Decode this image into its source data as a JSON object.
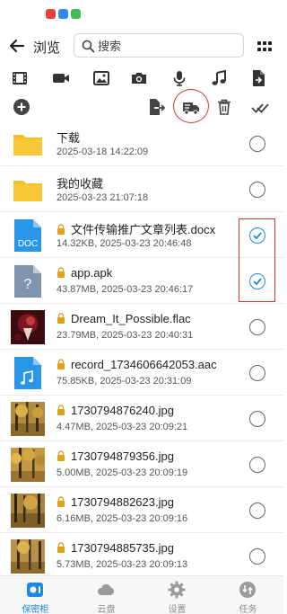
{
  "header": {
    "title": "浏览"
  },
  "search": {
    "placeholder": "搜索"
  },
  "colors": {
    "accent": "#1e88e5",
    "folder": "#f6c02d",
    "highlight": "#d8352b"
  },
  "file_types": [
    "film-icon",
    "video-icon",
    "image-icon",
    "camera-icon",
    "microphone-icon",
    "music-icon",
    "document-icon"
  ],
  "actions": [
    "add-icon",
    "export-icon",
    "move-icon",
    "delete-icon",
    "select-all-icon"
  ],
  "files": [
    {
      "name": "下载",
      "meta": "2025-03-18 14:22:09",
      "kind": "folder",
      "checked": false,
      "locked": false
    },
    {
      "name": "我的收藏",
      "meta": "2025-03-23 21:07:18",
      "kind": "folder",
      "checked": false,
      "locked": false
    },
    {
      "name": "文件传输推广文章列表.docx",
      "meta": "14.32KB, 2025-03-23 20:46:48",
      "kind": "doc",
      "badge": "DOC",
      "checked": true,
      "locked": true
    },
    {
      "name": "app.apk",
      "meta": "43.87MB, 2025-03-23 20:46:17",
      "kind": "unknown",
      "badge": "?",
      "checked": true,
      "locked": true
    },
    {
      "name": "Dream_It_Possible.flac",
      "meta": "23.79MB, 2025-03-23 20:40:31",
      "kind": "album",
      "checked": false,
      "locked": true
    },
    {
      "name": "record_1734606642053.aac",
      "meta": "75.85KB, 2025-03-23 20:31:09",
      "kind": "audio",
      "checked": false,
      "locked": true
    },
    {
      "name": "1730794876240.jpg",
      "meta": "4.47MB, 2025-03-23 20:09:21",
      "kind": "photo",
      "checked": false,
      "locked": true
    },
    {
      "name": "1730794879356.jpg",
      "meta": "5.00MB, 2025-03-23 20:09:19",
      "kind": "photo",
      "checked": false,
      "locked": true
    },
    {
      "name": "1730794882623.jpg",
      "meta": "6.16MB, 2025-03-23 20:09:16",
      "kind": "photo",
      "checked": false,
      "locked": true
    },
    {
      "name": "1730794885735.jpg",
      "meta": "5.73MB, 2025-03-23 20:09:13",
      "kind": "photo",
      "checked": false,
      "locked": true
    }
  ],
  "nav": [
    {
      "label": "保密柜",
      "icon": "vault-icon",
      "active": true
    },
    {
      "label": "云盘",
      "icon": "cloud-icon",
      "active": false
    },
    {
      "label": "设置",
      "icon": "gear-icon",
      "active": false
    },
    {
      "label": "任务",
      "icon": "task-icon",
      "active": false
    }
  ]
}
